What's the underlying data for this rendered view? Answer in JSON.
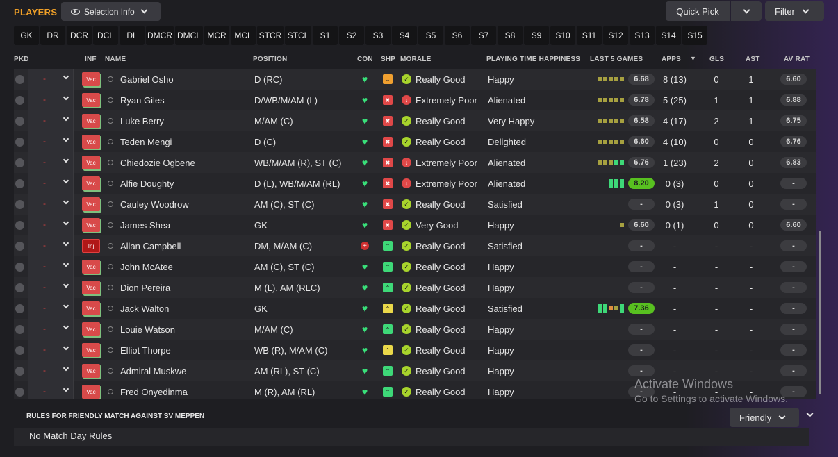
{
  "title": "PLAYERS",
  "selection_info": "Selection Info",
  "quick_pick": "Quick Pick",
  "filter": "Filter",
  "positions": [
    "GK",
    "DR",
    "DCR",
    "DCL",
    "DL",
    "DMCR",
    "DMCL",
    "MCR",
    "MCL",
    "STCR",
    "STCL",
    "S1",
    "S2",
    "S3",
    "S4",
    "S5",
    "S6",
    "S7",
    "S8",
    "S9",
    "S10",
    "S11",
    "S12",
    "S13",
    "S14",
    "S15"
  ],
  "headers": {
    "pkd": "PKD",
    "inf": "INF",
    "name": "NAME",
    "position": "POSITION",
    "con": "CON",
    "shp": "SHP",
    "morale": "MORALE",
    "happiness": "PLAYING TIME HAPPINESS",
    "last5": "LAST 5 GAMES",
    "apps": "APPS",
    "gls": "GLS",
    "ast": "AST",
    "avrat": "AV RAT"
  },
  "colors": {
    "accent": "#f0a028",
    "good": "#3ed878",
    "bad": "#e04848",
    "injury": "#b01818"
  },
  "players": [
    {
      "pkd": "-",
      "inf": "Vac",
      "name": "Gabriel Osho",
      "position": "D (RC)",
      "con": "heart",
      "shp": "orange",
      "morale_type": "good",
      "morale": "Really Good",
      "happiness": "Happy",
      "last5": [
        "olive",
        "olive",
        "olive",
        "olive",
        "olive"
      ],
      "rating5": "6.68",
      "apps": "8 (13)",
      "gls": "0",
      "ast": "1",
      "avrat": "6.60"
    },
    {
      "pkd": "-",
      "inf": "Vac",
      "name": "Ryan Giles",
      "position": "D/WB/M/AM (L)",
      "con": "heart",
      "shp": "red",
      "morale_type": "poor",
      "morale": "Extremely Poor",
      "happiness": "Alienated",
      "last5": [
        "olive",
        "olive",
        "olive",
        "olive",
        "olive"
      ],
      "rating5": "6.78",
      "apps": "5 (25)",
      "gls": "1",
      "ast": "1",
      "avrat": "6.88"
    },
    {
      "pkd": "-",
      "inf": "Vac",
      "name": "Luke Berry",
      "position": "M/AM (C)",
      "con": "heart",
      "shp": "red",
      "morale_type": "good",
      "morale": "Really Good",
      "happiness": "Very Happy",
      "last5": [
        "olive",
        "olive",
        "olive",
        "olive",
        "olive"
      ],
      "rating5": "6.58",
      "apps": "4 (17)",
      "gls": "2",
      "ast": "1",
      "avrat": "6.75"
    },
    {
      "pkd": "-",
      "inf": "Vac",
      "name": "Teden Mengi",
      "position": "D (C)",
      "con": "heart",
      "shp": "red",
      "morale_type": "good",
      "morale": "Really Good",
      "happiness": "Delighted",
      "last5": [
        "olive",
        "olive",
        "olive",
        "olive",
        "olive"
      ],
      "rating5": "6.60",
      "apps": "4 (10)",
      "gls": "0",
      "ast": "0",
      "avrat": "6.76"
    },
    {
      "pkd": "-",
      "inf": "Vac",
      "name": "Chiedozie Ogbene",
      "position": "WB/M/AM (R), ST (C)",
      "con": "heart",
      "shp": "red",
      "morale_type": "poor",
      "morale": "Extremely Poor",
      "happiness": "Alienated",
      "last5": [
        "olive",
        "olive",
        "olive",
        "green",
        "green"
      ],
      "rating5": "6.76",
      "apps": "1 (23)",
      "gls": "2",
      "ast": "0",
      "avrat": "6.83"
    },
    {
      "pkd": "-",
      "inf": "Vac",
      "name": "Alfie Doughty",
      "position": "D (L), WB/M/AM (RL)",
      "con": "heart",
      "shp": "red",
      "morale_type": "poor",
      "morale": "Extremely Poor",
      "happiness": "Alienated",
      "last5": [
        "green-tall",
        "green-tall",
        "green-tall"
      ],
      "rating5": "8.20",
      "rating5_hi": true,
      "apps": "0 (3)",
      "gls": "0",
      "ast": "0",
      "avrat": "-"
    },
    {
      "pkd": "-",
      "inf": "Vac",
      "name": "Cauley Woodrow",
      "position": "AM (C), ST (C)",
      "con": "heart",
      "shp": "red",
      "morale_type": "good",
      "morale": "Really Good",
      "happiness": "Satisfied",
      "last5": [],
      "rating5": "-",
      "apps": "0 (3)",
      "gls": "1",
      "ast": "0",
      "avrat": "-"
    },
    {
      "pkd": "-",
      "inf": "Vac",
      "name": "James Shea",
      "position": "GK",
      "con": "heart",
      "shp": "red",
      "morale_type": "good",
      "morale": "Very Good",
      "happiness": "Happy",
      "last5": [
        "olive"
      ],
      "rating5": "6.60",
      "apps": "0 (1)",
      "gls": "0",
      "ast": "0",
      "avrat": "6.60"
    },
    {
      "pkd": "-",
      "inf": "Inj",
      "name": "Allan Campbell",
      "position": "DM, M/AM (C)",
      "con": "injury",
      "shp": "green",
      "morale_type": "good",
      "morale": "Really Good",
      "happiness": "Satisfied",
      "last5": [],
      "rating5": "-",
      "apps": "-",
      "gls": "-",
      "ast": "-",
      "avrat": "-"
    },
    {
      "pkd": "-",
      "inf": "Vac",
      "name": "John McAtee",
      "position": "AM (C), ST (C)",
      "con": "heart",
      "shp": "green",
      "morale_type": "good",
      "morale": "Really Good",
      "happiness": "Happy",
      "last5": [],
      "rating5": "-",
      "apps": "-",
      "gls": "-",
      "ast": "-",
      "avrat": "-"
    },
    {
      "pkd": "-",
      "inf": "Vac",
      "name": "Dion Pereira",
      "position": "M (L), AM (RLC)",
      "con": "heart",
      "shp": "green",
      "morale_type": "good",
      "morale": "Really Good",
      "happiness": "Happy",
      "last5": [],
      "rating5": "-",
      "apps": "-",
      "gls": "-",
      "ast": "-",
      "avrat": "-"
    },
    {
      "pkd": "-",
      "inf": "Vac",
      "name": "Jack Walton",
      "position": "GK",
      "con": "heart",
      "shp": "yellow",
      "morale_type": "good",
      "morale": "Really Good",
      "happiness": "Satisfied",
      "last5": [
        "green-tall",
        "green-tall",
        "orange",
        "olive",
        "green-tall"
      ],
      "rating5": "7.36",
      "rating5_hi": true,
      "apps": "-",
      "gls": "-",
      "ast": "-",
      "avrat": "-"
    },
    {
      "pkd": "-",
      "inf": "Vac",
      "name": "Louie Watson",
      "position": "M/AM (C)",
      "con": "heart",
      "shp": "green",
      "morale_type": "good",
      "morale": "Really Good",
      "happiness": "Happy",
      "last5": [],
      "rating5": "-",
      "apps": "-",
      "gls": "-",
      "ast": "-",
      "avrat": "-"
    },
    {
      "pkd": "-",
      "inf": "Vac",
      "name": "Elliot Thorpe",
      "position": "WB (R), M/AM (C)",
      "con": "heart",
      "shp": "yellow",
      "morale_type": "good",
      "morale": "Really Good",
      "happiness": "Happy",
      "last5": [],
      "rating5": "-",
      "apps": "-",
      "gls": "-",
      "ast": "-",
      "avrat": "-"
    },
    {
      "pkd": "-",
      "inf": "Vac",
      "name": "Admiral Muskwe",
      "position": "AM (RL), ST (C)",
      "con": "heart",
      "shp": "green",
      "morale_type": "good",
      "morale": "Really Good",
      "happiness": "Happy",
      "last5": [],
      "rating5": "-",
      "apps": "-",
      "gls": "-",
      "ast": "-",
      "avrat": "-"
    },
    {
      "pkd": "-",
      "inf": "Vac",
      "name": "Fred Onyedinma",
      "position": "M (R), AM (RL)",
      "con": "heart",
      "shp": "green",
      "morale_type": "good",
      "morale": "Really Good",
      "happiness": "Happy",
      "last5": [],
      "rating5": "-",
      "apps": "-",
      "gls": "-",
      "ast": "-",
      "avrat": "-"
    }
  ],
  "footer": {
    "rules_title": "RULES FOR FRIENDLY MATCH AGAINST SV MEPPEN",
    "rules_text": "No Match Day Rules",
    "friendly": "Friendly"
  },
  "watermark": {
    "line1": "Activate Windows",
    "line2": "Go to Settings to activate Windows."
  }
}
